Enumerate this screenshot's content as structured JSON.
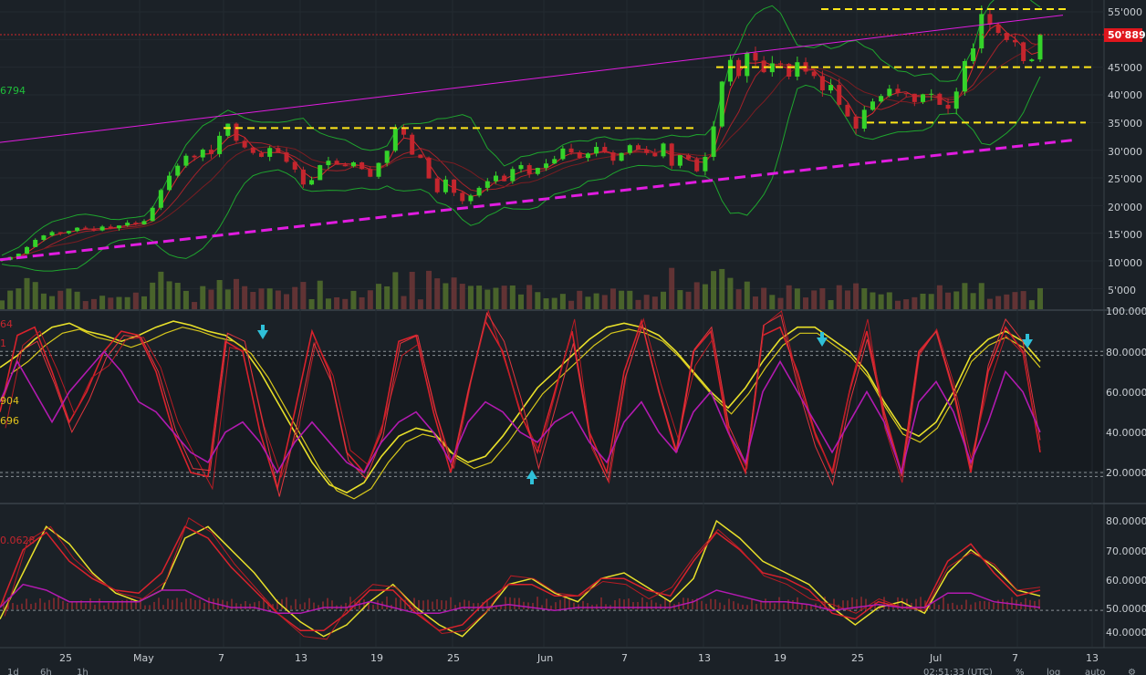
{
  "price_axis": {
    "labels": [
      "55'000",
      "50'000",
      "45'000",
      "40'000",
      "35'000",
      "30'000",
      "25'000",
      "20'000",
      "15'000",
      "10'000",
      "5'000"
    ],
    "current_price": "50'889"
  },
  "stoch_axis": {
    "labels": [
      "100.0000",
      "80.0000",
      "60.0000",
      "40.0000",
      "20.0000"
    ]
  },
  "rsi_axis": {
    "labels": [
      "80.0000",
      "70.0000",
      "60.0000",
      "50.0000",
      "40.0000"
    ]
  },
  "time_axis": {
    "labels": [
      "25",
      "May",
      "7",
      "13",
      "19",
      "25",
      "Jun",
      "7",
      "13",
      "19",
      "25",
      "Jul",
      "7",
      "13"
    ]
  },
  "left_labels": {
    "main_value": "6794",
    "stoch_top1": "64",
    "stoch_top2": "1",
    "stoch_mid1": "904",
    "stoch_mid2": "696",
    "rsi_value": "0.0628"
  },
  "bottom_bar": {
    "intervals": [
      "1d",
      "6h",
      "1h"
    ],
    "clock": "02:51:33 (UTC)",
    "percent": "%",
    "log": "log",
    "auto": "auto"
  },
  "colors": {
    "bull": "#35d32a",
    "bear": "#c4262e",
    "bollinger": "#1fa52e",
    "trend_yellow": "#ffe71a",
    "trend_magenta": "#e11ce0",
    "price_line": "#d6262b",
    "arrow": "#2fc0d8"
  },
  "chart_data": [
    {
      "type": "candlestick",
      "title": "",
      "y_axis_ticks": [
        5000,
        10000,
        15000,
        20000,
        25000,
        30000,
        35000,
        40000,
        45000,
        50000,
        55000
      ],
      "x_axis_ticks": [
        "25",
        "May",
        "7",
        "13",
        "19",
        "25",
        "Jun",
        "7",
        "13",
        "19",
        "25",
        "Jul",
        "7",
        "13"
      ],
      "current_price": 50889,
      "close_series": [
        10200,
        10700,
        11300,
        12500,
        13800,
        14600,
        15200,
        15000,
        15400,
        16000,
        15800,
        15500,
        16200,
        15900,
        16400,
        16900,
        16600,
        17200,
        19600,
        22800,
        25400,
        27200,
        29000,
        28700,
        30100,
        29300,
        32600,
        34800,
        31700,
        30500,
        29500,
        28800,
        30400,
        29600,
        27900,
        26500,
        23800,
        24600,
        27300,
        28100,
        27400,
        27100,
        27800,
        26600,
        25200,
        27700,
        29900,
        33900,
        32800,
        29200,
        28600,
        24900,
        22400,
        24700,
        22300,
        20800,
        21800,
        23200,
        24400,
        25400,
        24400,
        26600,
        27300,
        25700,
        26800,
        27600,
        28400,
        30300,
        29600,
        28600,
        29400,
        30600,
        29600,
        28100,
        29500,
        30900,
        30100,
        29500,
        28900,
        31200,
        27200,
        29100,
        28400,
        26200,
        28800,
        34300,
        42400,
        46300,
        43400,
        47600,
        46200,
        44100,
        45700,
        45600,
        43300,
        45900,
        44200,
        43400,
        40800,
        41800,
        38200,
        36100,
        33900,
        37300,
        38800,
        39800,
        41100,
        40300,
        40200,
        38700,
        40100,
        40200,
        38200,
        37500,
        40600,
        46100,
        48400,
        54600,
        52700,
        51200,
        49900,
        49500,
        46100,
        46400,
        50889
      ],
      "trendlines": [
        {
          "color": "yellow",
          "kind": "horizontal",
          "value": 34000
        },
        {
          "color": "yellow",
          "kind": "horizontal",
          "value": 45000
        },
        {
          "color": "yellow",
          "kind": "horizontal",
          "value": 35000
        },
        {
          "color": "yellow",
          "kind": "horizontal",
          "value": 55500
        },
        {
          "color": "magenta",
          "kind": "sloped support",
          "from": 10200,
          "to": 31900
        },
        {
          "color": "magenta",
          "kind": "sloped resistance",
          "from": 31400,
          "to": 54400
        }
      ]
    },
    {
      "type": "line",
      "title": "",
      "y_axis_ticks": [
        20,
        40,
        60,
        80,
        100
      ],
      "x_axis_ticks": [
        "25",
        "May",
        "7",
        "13",
        "19",
        "25",
        "Jun",
        "7",
        "13",
        "19",
        "25",
        "Jul",
        "7",
        "13"
      ],
      "reference_lines": [
        80,
        78,
        20,
        18
      ],
      "series": [
        {
          "color": "yellow",
          "values": [
            72,
            78,
            86,
            92,
            94,
            90,
            88,
            85,
            88,
            92,
            95,
            93,
            90,
            88,
            82,
            70,
            55,
            40,
            25,
            14,
            10,
            15,
            28,
            38,
            42,
            40,
            30,
            25,
            28,
            38,
            50,
            62,
            70,
            78,
            86,
            92,
            94,
            92,
            88,
            80,
            70,
            60,
            52,
            62,
            75,
            86,
            92,
            92,
            86,
            80,
            70,
            55,
            42,
            38,
            45,
            60,
            78,
            86,
            90,
            85,
            75
          ]
        },
        {
          "color": "red",
          "values": [
            50,
            88,
            92,
            70,
            45,
            60,
            80,
            90,
            88,
            70,
            40,
            20,
            18,
            85,
            80,
            40,
            12,
            50,
            90,
            70,
            30,
            20,
            40,
            85,
            88,
            50,
            20,
            60,
            95,
            80,
            50,
            30,
            60,
            90,
            40,
            20,
            70,
            95,
            60,
            30,
            80,
            90,
            40,
            20,
            88,
            92,
            70,
            40,
            20,
            60,
            90,
            50,
            20,
            80,
            90,
            60,
            20,
            70,
            92,
            80,
            30
          ]
        },
        {
          "color": "purple",
          "values": [
            55,
            75,
            60,
            45,
            60,
            70,
            80,
            70,
            55,
            50,
            40,
            30,
            25,
            40,
            45,
            35,
            20,
            35,
            45,
            35,
            25,
            20,
            35,
            45,
            50,
            40,
            25,
            45,
            55,
            50,
            40,
            35,
            45,
            50,
            35,
            25,
            45,
            55,
            40,
            30,
            50,
            60,
            40,
            25,
            60,
            75,
            60,
            45,
            30,
            45,
            60,
            45,
            20,
            55,
            65,
            50,
            25,
            45,
            70,
            60,
            40
          ]
        }
      ],
      "markers": [
        {
          "type": "sell arrow",
          "position": "early May"
        },
        {
          "type": "buy arrow",
          "position": "early Jun"
        },
        {
          "type": "sell arrow",
          "position": "late Jun"
        },
        {
          "type": "sell arrow",
          "position": "mid Jul"
        }
      ]
    },
    {
      "type": "line",
      "title": "",
      "y_axis_ticks": [
        40,
        50,
        60,
        70,
        80
      ],
      "x_axis_ticks": [
        "25",
        "May",
        "7",
        "13",
        "19",
        "25",
        "Jun",
        "7",
        "13",
        "19",
        "25",
        "Jul",
        "7",
        "13"
      ],
      "reference_lines": [
        49
      ],
      "series": [
        {
          "color": "yellow",
          "values": [
            46,
            62,
            78,
            72,
            62,
            55,
            52,
            56,
            74,
            78,
            70,
            62,
            52,
            45,
            40,
            44,
            52,
            58,
            50,
            44,
            40,
            48,
            58,
            60,
            55,
            52,
            60,
            62,
            57,
            52,
            60,
            80,
            74,
            66,
            62,
            58,
            50,
            44,
            50,
            52,
            48,
            62,
            70,
            64,
            56,
            54
          ]
        },
        {
          "color": "red",
          "values": [
            50,
            70,
            76,
            66,
            60,
            56,
            55,
            62,
            78,
            74,
            64,
            56,
            48,
            42,
            42,
            48,
            56,
            56,
            48,
            42,
            44,
            52,
            58,
            58,
            54,
            54,
            60,
            60,
            56,
            54,
            66,
            76,
            70,
            62,
            60,
            56,
            48,
            46,
            52,
            50,
            50,
            66,
            72,
            62,
            54,
            56
          ]
        },
        {
          "color": "purple",
          "values": [
            50,
            58,
            56,
            52,
            52,
            52,
            52,
            56,
            56,
            52,
            50,
            50,
            48,
            48,
            50,
            50,
            52,
            50,
            48,
            48,
            50,
            50,
            51,
            50,
            49,
            50,
            50,
            50,
            50,
            50,
            52,
            56,
            54,
            52,
            52,
            51,
            49,
            50,
            51,
            50,
            50,
            55,
            55,
            52,
            51,
            50
          ]
        }
      ]
    }
  ]
}
